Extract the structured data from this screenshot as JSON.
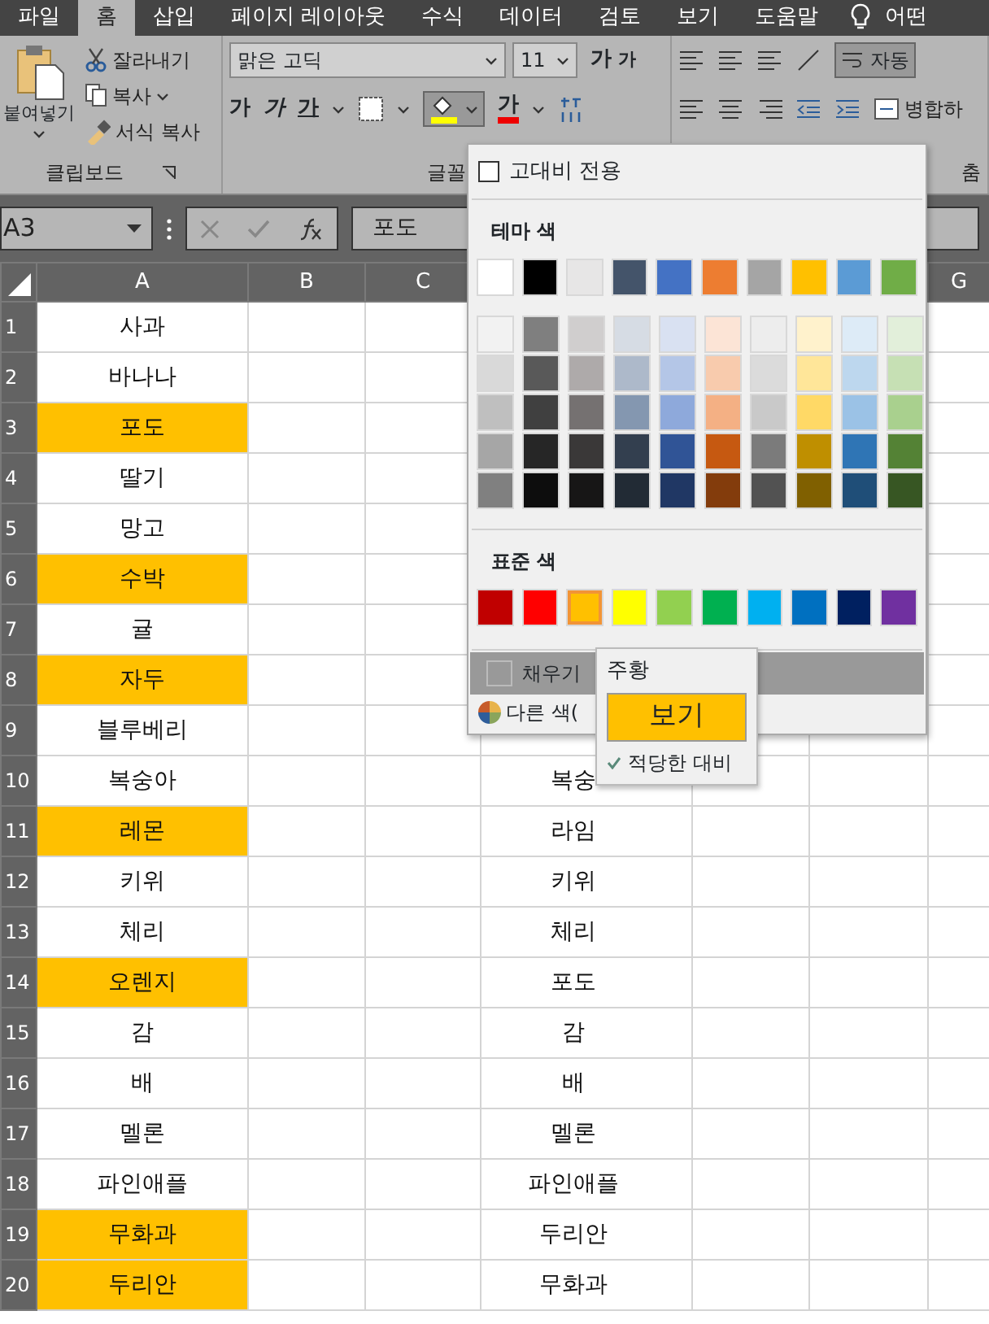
{
  "ribbon_tabs": [
    {
      "label": "파일",
      "selected": false
    },
    {
      "label": "홈",
      "selected": true
    },
    {
      "label": "삽입",
      "selected": false
    },
    {
      "label": "페이지 레이아웃",
      "selected": false
    },
    {
      "label": "수식",
      "selected": false
    },
    {
      "label": "데이터",
      "selected": false
    },
    {
      "label": "검토",
      "selected": false
    },
    {
      "label": "보기",
      "selected": false
    },
    {
      "label": "도움말",
      "selected": false
    }
  ],
  "tell_me": "어떤",
  "clipboard": {
    "paste": "붙여넣기",
    "cut": "잘라내기",
    "copy": "복사",
    "format_painter": "서식 복사",
    "label": "클립보드"
  },
  "font": {
    "name": "맑은 고딕",
    "size": "11",
    "grow": "가",
    "shrink": "가",
    "bold": "가",
    "italic": "가",
    "underline": "가",
    "font_color": "가",
    "label": "글꼴"
  },
  "alignment": {
    "wrap": "자동",
    "merge": "병합하",
    "label": "춤"
  },
  "formula_bar": {
    "name_box": "A3",
    "value": "포도"
  },
  "columns": [
    "A",
    "B",
    "C"
  ],
  "columns_right": [
    "G"
  ],
  "rows": [
    {
      "number": "1",
      "a": "사과",
      "highlighted": false
    },
    {
      "number": "2",
      "a": "바나나",
      "highlighted": false
    },
    {
      "number": "3",
      "a": "포도",
      "highlighted": true
    },
    {
      "number": "4",
      "a": "딸기",
      "highlighted": false
    },
    {
      "number": "5",
      "a": "망고",
      "highlighted": false
    },
    {
      "number": "6",
      "a": "수박",
      "highlighted": true
    },
    {
      "number": "7",
      "a": "귤",
      "highlighted": false
    },
    {
      "number": "8",
      "a": "자두",
      "highlighted": true
    },
    {
      "number": "9",
      "a": "블루베리",
      "highlighted": false
    },
    {
      "number": "10",
      "a": "복숭아",
      "highlighted": false,
      "d": "복숭"
    },
    {
      "number": "11",
      "a": "레몬",
      "highlighted": true,
      "d": "라임"
    },
    {
      "number": "12",
      "a": "키위",
      "highlighted": false,
      "d": "키위"
    },
    {
      "number": "13",
      "a": "체리",
      "highlighted": false,
      "d": "체리"
    },
    {
      "number": "14",
      "a": "오렌지",
      "highlighted": true,
      "d": "포도"
    },
    {
      "number": "15",
      "a": "감",
      "highlighted": false,
      "d": "감"
    },
    {
      "number": "16",
      "a": "배",
      "highlighted": false,
      "d": "배"
    },
    {
      "number": "17",
      "a": "멜론",
      "highlighted": false,
      "d": "멜론"
    },
    {
      "number": "18",
      "a": "파인애플",
      "highlighted": false,
      "d": "파인애플"
    },
    {
      "number": "19",
      "a": "무화과",
      "highlighted": true,
      "d": "두리안"
    },
    {
      "number": "20",
      "a": "두리안",
      "highlighted": true,
      "d": "무화과"
    }
  ],
  "color_menu": {
    "high_contrast": {
      "label": "고대비 전용",
      "checked": false
    },
    "theme_header": "테마 색",
    "theme_colors": [
      {
        "color": "#ffffff",
        "shades": [
          {
            "color": "#f2f2f2"
          },
          {
            "color": "#d9d9d9"
          },
          {
            "color": "#bfbfbf"
          },
          {
            "color": "#a6a6a6"
          },
          {
            "color": "#808080"
          }
        ]
      },
      {
        "color": "#000000",
        "shades": [
          {
            "color": "#7f7f7f"
          },
          {
            "color": "#595959"
          },
          {
            "color": "#404040"
          },
          {
            "color": "#262626"
          },
          {
            "color": "#0d0d0d"
          }
        ]
      },
      {
        "color": "#e7e6e6",
        "shades": [
          {
            "color": "#d0cece"
          },
          {
            "color": "#aeaaaa"
          },
          {
            "color": "#757171"
          },
          {
            "color": "#3a3838"
          },
          {
            "color": "#171616"
          }
        ]
      },
      {
        "color": "#44546a",
        "shades": [
          {
            "color": "#d6dce4"
          },
          {
            "color": "#adb9ca"
          },
          {
            "color": "#8497b0"
          },
          {
            "color": "#333f4f"
          },
          {
            "color": "#222b35"
          }
        ]
      },
      {
        "color": "#4472c4",
        "shades": [
          {
            "color": "#d9e1f2"
          },
          {
            "color": "#b4c6e7"
          },
          {
            "color": "#8ea9db"
          },
          {
            "color": "#305496"
          },
          {
            "color": "#203764"
          }
        ]
      },
      {
        "color": "#ed7d31",
        "shades": [
          {
            "color": "#fce4d6"
          },
          {
            "color": "#f8cbad"
          },
          {
            "color": "#f4b084"
          },
          {
            "color": "#c65911"
          },
          {
            "color": "#833c0c"
          }
        ]
      },
      {
        "color": "#a5a5a5",
        "shades": [
          {
            "color": "#ededed"
          },
          {
            "color": "#dbdbdb"
          },
          {
            "color": "#c9c9c9"
          },
          {
            "color": "#7b7b7b"
          },
          {
            "color": "#525252"
          }
        ]
      },
      {
        "color": "#ffc000",
        "shades": [
          {
            "color": "#fff2cc"
          },
          {
            "color": "#ffe699"
          },
          {
            "color": "#ffd966"
          },
          {
            "color": "#bf8f00"
          },
          {
            "color": "#806000"
          }
        ]
      },
      {
        "color": "#5b9bd5",
        "shades": [
          {
            "color": "#ddebf7"
          },
          {
            "color": "#bdd7ee"
          },
          {
            "color": "#9bc2e6"
          },
          {
            "color": "#2f75b5"
          },
          {
            "color": "#1f4e78"
          }
        ]
      },
      {
        "color": "#70ad47",
        "shades": [
          {
            "color": "#e2efda"
          },
          {
            "color": "#c6e0b4"
          },
          {
            "color": "#a9d08e"
          },
          {
            "color": "#548235"
          },
          {
            "color": "#375623"
          }
        ]
      }
    ],
    "standard_header": "표준 색",
    "standard_colors": [
      {
        "color": "#c00000",
        "selected": false
      },
      {
        "color": "#ff0000",
        "selected": false
      },
      {
        "color": "#ffc000",
        "selected": true
      },
      {
        "color": "#ffff00",
        "selected": false
      },
      {
        "color": "#92d050",
        "selected": false
      },
      {
        "color": "#00b050",
        "selected": false
      },
      {
        "color": "#00b0f0",
        "selected": false
      },
      {
        "color": "#0070c0",
        "selected": false
      },
      {
        "color": "#002060",
        "selected": false
      },
      {
        "color": "#7030a0",
        "selected": false
      }
    ],
    "no_fill": "채우기",
    "more_colors": "다른 색("
  },
  "tooltip": {
    "name": "주황",
    "preview": "보기",
    "contrast": "적당한 대비"
  }
}
